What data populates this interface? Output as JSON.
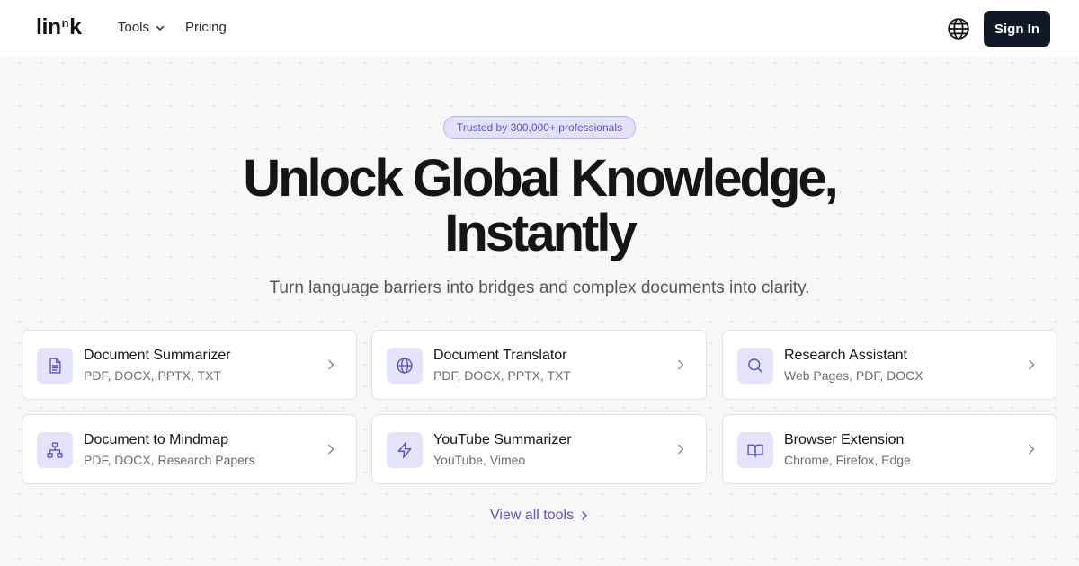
{
  "header": {
    "logo": {
      "main": "lin",
      "sup": "n",
      "end": "k"
    },
    "nav": {
      "tools_label": "Tools",
      "pricing_label": "Pricing"
    },
    "language_icon": "globe-icon",
    "sign_in_label": "Sign In"
  },
  "hero": {
    "badge": "Trusted by 300,000+ professionals",
    "headline_line1": "Unlock Global Knowledge,",
    "headline_line2": "Instantly",
    "subtitle": "Turn language barriers into bridges and complex documents into clarity."
  },
  "tools": [
    {
      "title": "Document Summarizer",
      "subtitle": "PDF, DOCX, PPTX, TXT",
      "icon": "document-icon"
    },
    {
      "title": "Document Translator",
      "subtitle": "PDF, DOCX, PPTX, TXT",
      "icon": "globe-icon"
    },
    {
      "title": "Research Assistant",
      "subtitle": "Web Pages, PDF, DOCX",
      "icon": "search-icon"
    },
    {
      "title": "Document to Mindmap",
      "subtitle": "PDF, DOCX, Research Papers",
      "icon": "sitemap-icon"
    },
    {
      "title": "YouTube Summarizer",
      "subtitle": "YouTube, Vimeo",
      "icon": "lightning-icon"
    },
    {
      "title": "Browser Extension",
      "subtitle": "Chrome, Firefox, Edge",
      "icon": "book-icon"
    }
  ],
  "view_all_label": "View all tools",
  "colors": {
    "accent": "#5b57c2",
    "badge_bg": "#e3e1fb",
    "icon_bg": "#e4e3fa",
    "sign_in_bg": "#111827",
    "page_bg": "#f7f7f8"
  }
}
